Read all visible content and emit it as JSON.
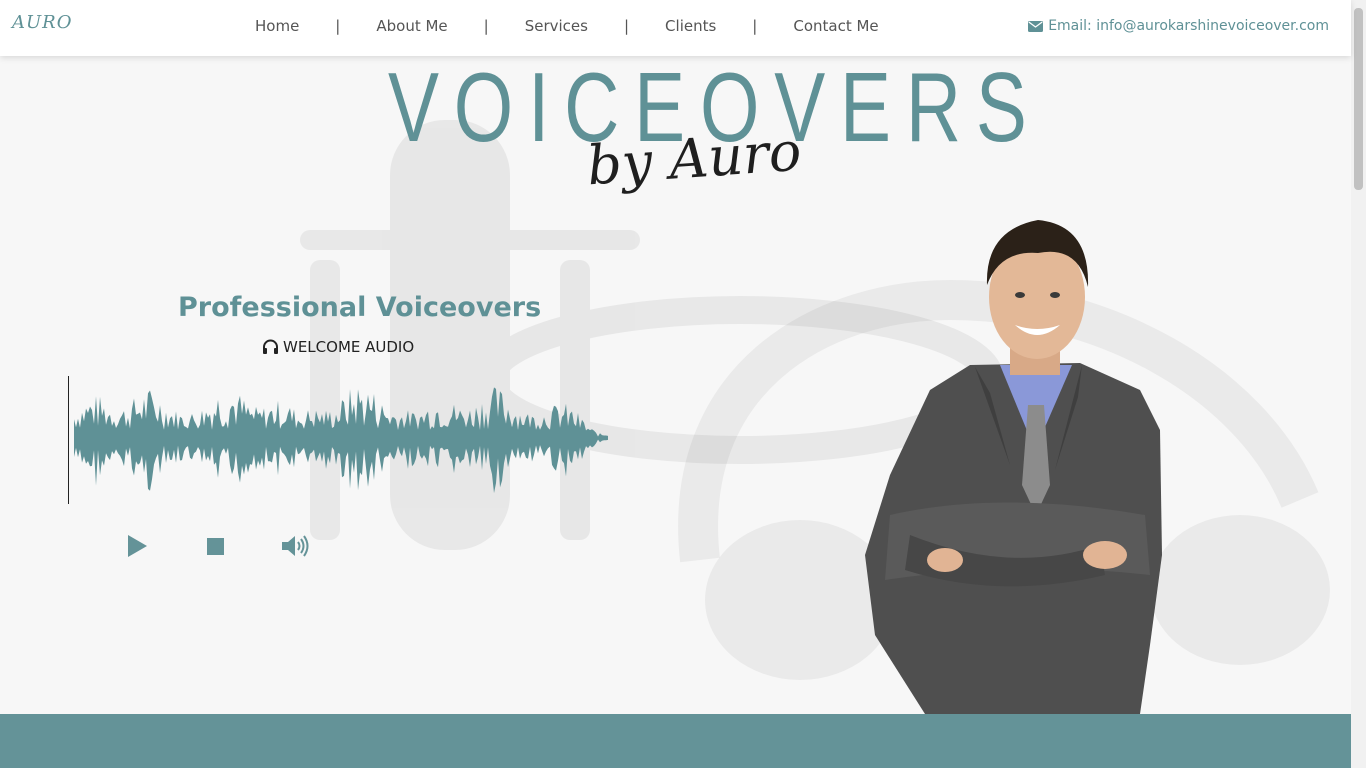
{
  "header": {
    "logo": "AURO",
    "nav": [
      "Home",
      "About Me",
      "Services",
      "Clients",
      "Contact Me"
    ],
    "nav_separator": "|",
    "email_label": "Email: info@aurokarshinevoiceover.com",
    "email_icon": "envelope-icon"
  },
  "hero": {
    "title": "VOICEOVERS",
    "subtitle": "by Auro"
  },
  "audio": {
    "heading": "Professional Voiceovers",
    "track_label": "WELCOME AUDIO",
    "track_icon": "headphones-icon",
    "controls": [
      "play-icon",
      "stop-icon",
      "volume-icon"
    ]
  },
  "colors": {
    "accent": "#5f9196",
    "band": "#649398",
    "background": "#f7f7f7"
  }
}
